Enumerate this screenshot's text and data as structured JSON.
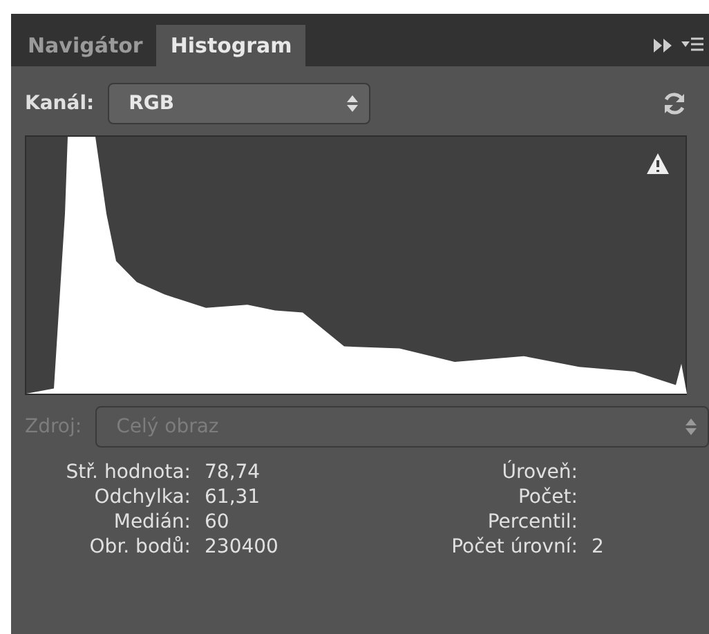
{
  "tabs": [
    {
      "label": "Navigátor",
      "selected": false
    },
    {
      "label": "Histogram",
      "selected": true
    }
  ],
  "channel": {
    "label": "Kanál:",
    "value": "RGB"
  },
  "source": {
    "label": "Zdroj:",
    "value": "Celý obraz",
    "disabled": true
  },
  "warning": true,
  "stats_left": [
    {
      "label": "Stř. hodnota:",
      "value": "78,74"
    },
    {
      "label": "Odchylka:",
      "value": "61,31"
    },
    {
      "label": "Medián:",
      "value": "60"
    },
    {
      "label": "Obr. bodů:",
      "value": "230400"
    }
  ],
  "stats_right": [
    {
      "label": "Úroveň:"
    },
    {
      "label": "Počet:"
    },
    {
      "label": "Percentil:"
    },
    {
      "label": "Počet úrovní:",
      "value": "2"
    }
  ]
}
